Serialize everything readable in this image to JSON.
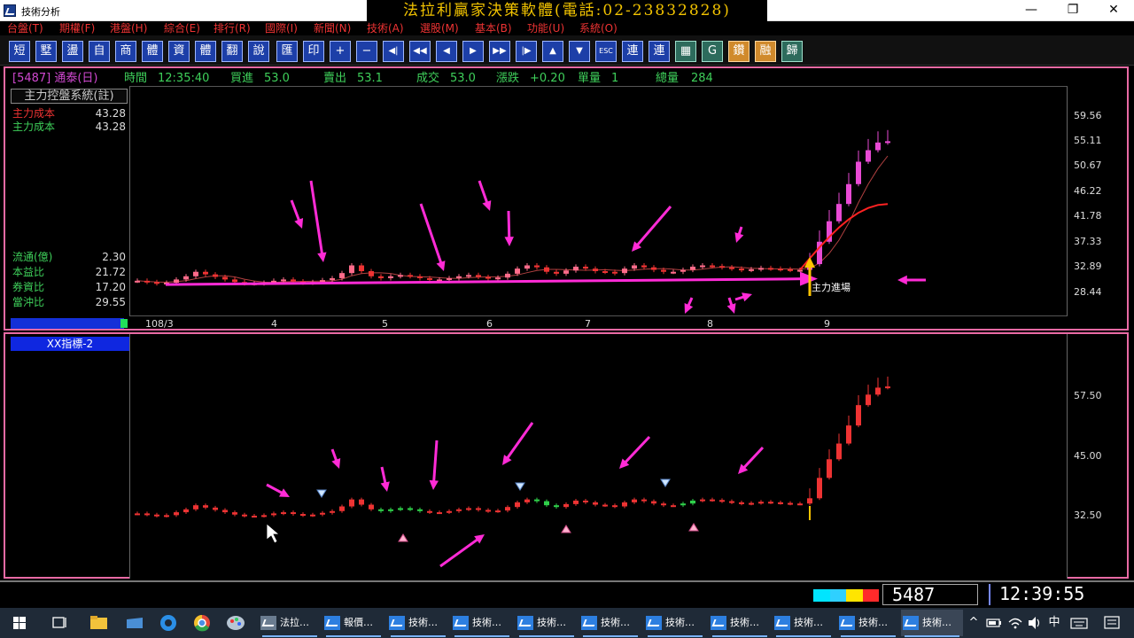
{
  "window": {
    "title": "技術分析",
    "banner": "法拉利贏家決策軟體(電話:02-23832828)",
    "minimize": "—",
    "maximize": "❐",
    "close": "✕"
  },
  "menu": [
    "台盤(T)",
    "期權(F)",
    "港盤(H)",
    "綜合(E)",
    "排行(R)",
    "國際(I)",
    "新聞(N)",
    "技術(A)",
    "選股(M)",
    "基本(B)",
    "功能(U)",
    "系統(O)"
  ],
  "toolbar": [
    "短",
    "墅",
    "盪",
    "自",
    "商",
    "體",
    "資",
    "體",
    "翻",
    "說",
    "匯",
    "印",
    "+",
    "−",
    "◀|",
    "◀◀",
    "◀",
    "▶",
    "▶▶",
    "|▶",
    "▲",
    "▼",
    "ESC",
    "連",
    "連",
    "▦",
    "G",
    "鑽",
    "融",
    "歸"
  ],
  "quote": {
    "code_name": "[5487] 通泰(日)",
    "time_label": "時間",
    "time": "12:35:40",
    "buy_label": "買進",
    "buy": "53.0",
    "sell_label": "賣出",
    "sell": "53.1",
    "deal_label": "成交",
    "deal": "53.0",
    "change_label": "漲跌",
    "change": "+0.20",
    "unit_label": "單量",
    "unit": "1",
    "vol_label": "總量",
    "vol": "284"
  },
  "system_title": "主力控盤系統(註)",
  "cost_rows": [
    {
      "label": "主力成本",
      "value": "43.28",
      "color": "#e33"
    },
    {
      "label": "主力成本",
      "value": "43.28",
      "color": "#3ecf5a"
    }
  ],
  "fundamentals": [
    {
      "label": "流通(億)",
      "value": "2.30"
    },
    {
      "label": "本益比",
      "value": "21.72"
    },
    {
      "label": "券資比",
      "value": "17.20"
    },
    {
      "label": "當沖比",
      "value": "29.55"
    }
  ],
  "indicator_label": "XX指標-2",
  "annotation": "主力進場",
  "chart_data": [
    {
      "type": "candlestick",
      "y_ticks": [
        "59.56",
        "55.11",
        "50.67",
        "46.22",
        "41.78",
        "37.33",
        "32.89",
        "28.44"
      ],
      "x_ticks": [
        "108/3",
        "4",
        "5",
        "6",
        "7",
        "8",
        "9"
      ],
      "ylim": [
        25.5,
        61.5
      ],
      "closes": [
        31.2,
        31.0,
        30.8,
        30.9,
        31.4,
        31.9,
        32.6,
        32.2,
        31.8,
        31.4,
        31.0,
        30.8,
        30.8,
        30.9,
        31.2,
        31.4,
        31.1,
        30.9,
        31.0,
        31.3,
        31.6,
        32.4,
        33.6,
        32.7,
        31.9,
        31.6,
        31.9,
        32.1,
        31.9,
        31.6,
        31.4,
        31.4,
        31.6,
        31.9,
        32.1,
        31.8,
        31.6,
        31.7,
        32.3,
        33.1,
        33.6,
        33.3,
        32.6,
        32.3,
        32.8,
        33.4,
        33.1,
        32.7,
        32.6,
        32.4,
        33.1,
        33.6,
        33.3,
        32.9,
        32.6,
        32.6,
        32.9,
        33.4,
        33.6,
        33.5,
        33.3,
        33.1,
        32.9,
        33.0,
        33.2,
        33.1,
        33.0,
        32.9,
        32.9,
        33.8,
        37.3,
        40.5,
        43.2,
        46.3,
        49.8,
        51.6,
        52.8,
        53.0
      ],
      "cost_line": {
        "start_index": 68,
        "start": 32.9,
        "end": 43.2
      }
    },
    {
      "type": "candlestick",
      "y_ticks": [
        "57.50",
        "45.00",
        "32.50"
      ],
      "ylim": [
        20.0,
        62.0
      ]
    }
  ],
  "status": {
    "code": "5487",
    "time": "12:39:55"
  },
  "taskbar": {
    "tasks": [
      "法拉…",
      "報價…",
      "技術…",
      "技術…",
      "技術…",
      "技術…",
      "技術…",
      "技術…",
      "技術…",
      "技術…",
      "技術…"
    ],
    "tray_lang": "中",
    "tray_arrow": "^"
  }
}
